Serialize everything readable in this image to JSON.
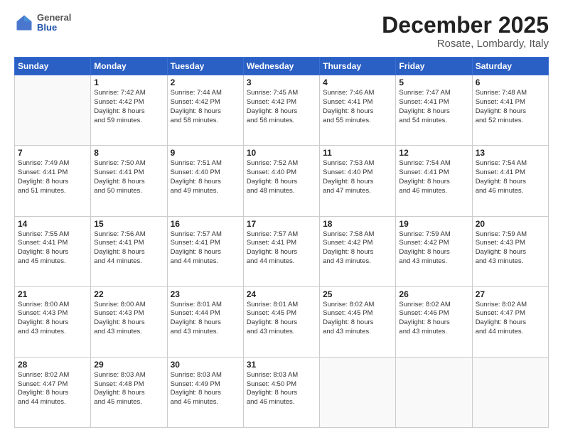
{
  "header": {
    "logo": {
      "general": "General",
      "blue": "Blue"
    },
    "title": "December 2025",
    "location": "Rosate, Lombardy, Italy"
  },
  "days_of_week": [
    "Sunday",
    "Monday",
    "Tuesday",
    "Wednesday",
    "Thursday",
    "Friday",
    "Saturday"
  ],
  "weeks": [
    [
      {
        "day": "",
        "info": ""
      },
      {
        "day": "1",
        "info": "Sunrise: 7:42 AM\nSunset: 4:42 PM\nDaylight: 8 hours\nand 59 minutes."
      },
      {
        "day": "2",
        "info": "Sunrise: 7:44 AM\nSunset: 4:42 PM\nDaylight: 8 hours\nand 58 minutes."
      },
      {
        "day": "3",
        "info": "Sunrise: 7:45 AM\nSunset: 4:42 PM\nDaylight: 8 hours\nand 56 minutes."
      },
      {
        "day": "4",
        "info": "Sunrise: 7:46 AM\nSunset: 4:41 PM\nDaylight: 8 hours\nand 55 minutes."
      },
      {
        "day": "5",
        "info": "Sunrise: 7:47 AM\nSunset: 4:41 PM\nDaylight: 8 hours\nand 54 minutes."
      },
      {
        "day": "6",
        "info": "Sunrise: 7:48 AM\nSunset: 4:41 PM\nDaylight: 8 hours\nand 52 minutes."
      }
    ],
    [
      {
        "day": "7",
        "info": "Sunrise: 7:49 AM\nSunset: 4:41 PM\nDaylight: 8 hours\nand 51 minutes."
      },
      {
        "day": "8",
        "info": "Sunrise: 7:50 AM\nSunset: 4:41 PM\nDaylight: 8 hours\nand 50 minutes."
      },
      {
        "day": "9",
        "info": "Sunrise: 7:51 AM\nSunset: 4:40 PM\nDaylight: 8 hours\nand 49 minutes."
      },
      {
        "day": "10",
        "info": "Sunrise: 7:52 AM\nSunset: 4:40 PM\nDaylight: 8 hours\nand 48 minutes."
      },
      {
        "day": "11",
        "info": "Sunrise: 7:53 AM\nSunset: 4:40 PM\nDaylight: 8 hours\nand 47 minutes."
      },
      {
        "day": "12",
        "info": "Sunrise: 7:54 AM\nSunset: 4:41 PM\nDaylight: 8 hours\nand 46 minutes."
      },
      {
        "day": "13",
        "info": "Sunrise: 7:54 AM\nSunset: 4:41 PM\nDaylight: 8 hours\nand 46 minutes."
      }
    ],
    [
      {
        "day": "14",
        "info": "Sunrise: 7:55 AM\nSunset: 4:41 PM\nDaylight: 8 hours\nand 45 minutes."
      },
      {
        "day": "15",
        "info": "Sunrise: 7:56 AM\nSunset: 4:41 PM\nDaylight: 8 hours\nand 44 minutes."
      },
      {
        "day": "16",
        "info": "Sunrise: 7:57 AM\nSunset: 4:41 PM\nDaylight: 8 hours\nand 44 minutes."
      },
      {
        "day": "17",
        "info": "Sunrise: 7:57 AM\nSunset: 4:41 PM\nDaylight: 8 hours\nand 44 minutes."
      },
      {
        "day": "18",
        "info": "Sunrise: 7:58 AM\nSunset: 4:42 PM\nDaylight: 8 hours\nand 43 minutes."
      },
      {
        "day": "19",
        "info": "Sunrise: 7:59 AM\nSunset: 4:42 PM\nDaylight: 8 hours\nand 43 minutes."
      },
      {
        "day": "20",
        "info": "Sunrise: 7:59 AM\nSunset: 4:43 PM\nDaylight: 8 hours\nand 43 minutes."
      }
    ],
    [
      {
        "day": "21",
        "info": "Sunrise: 8:00 AM\nSunset: 4:43 PM\nDaylight: 8 hours\nand 43 minutes."
      },
      {
        "day": "22",
        "info": "Sunrise: 8:00 AM\nSunset: 4:43 PM\nDaylight: 8 hours\nand 43 minutes."
      },
      {
        "day": "23",
        "info": "Sunrise: 8:01 AM\nSunset: 4:44 PM\nDaylight: 8 hours\nand 43 minutes."
      },
      {
        "day": "24",
        "info": "Sunrise: 8:01 AM\nSunset: 4:45 PM\nDaylight: 8 hours\nand 43 minutes."
      },
      {
        "day": "25",
        "info": "Sunrise: 8:02 AM\nSunset: 4:45 PM\nDaylight: 8 hours\nand 43 minutes."
      },
      {
        "day": "26",
        "info": "Sunrise: 8:02 AM\nSunset: 4:46 PM\nDaylight: 8 hours\nand 43 minutes."
      },
      {
        "day": "27",
        "info": "Sunrise: 8:02 AM\nSunset: 4:47 PM\nDaylight: 8 hours\nand 44 minutes."
      }
    ],
    [
      {
        "day": "28",
        "info": "Sunrise: 8:02 AM\nSunset: 4:47 PM\nDaylight: 8 hours\nand 44 minutes."
      },
      {
        "day": "29",
        "info": "Sunrise: 8:03 AM\nSunset: 4:48 PM\nDaylight: 8 hours\nand 45 minutes."
      },
      {
        "day": "30",
        "info": "Sunrise: 8:03 AM\nSunset: 4:49 PM\nDaylight: 8 hours\nand 46 minutes."
      },
      {
        "day": "31",
        "info": "Sunrise: 8:03 AM\nSunset: 4:50 PM\nDaylight: 8 hours\nand 46 minutes."
      },
      {
        "day": "",
        "info": ""
      },
      {
        "day": "",
        "info": ""
      },
      {
        "day": "",
        "info": ""
      }
    ]
  ]
}
